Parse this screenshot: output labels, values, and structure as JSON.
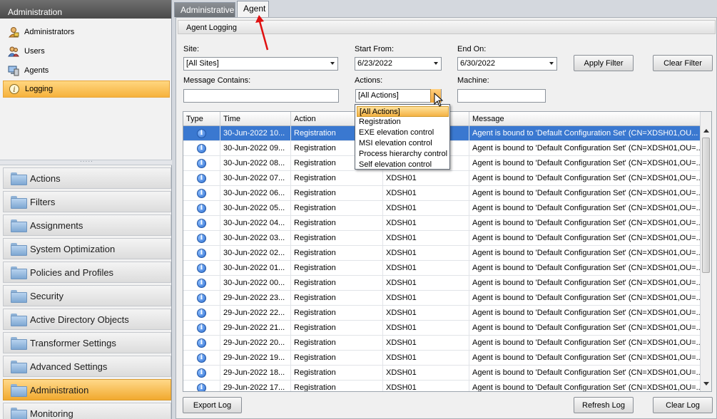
{
  "left": {
    "header": "Administration",
    "items": [
      {
        "label": "Administrators",
        "icon": "administrators-icon"
      },
      {
        "label": "Users",
        "icon": "users-icon"
      },
      {
        "label": "Agents",
        "icon": "agents-icon"
      },
      {
        "label": "Logging",
        "icon": "info-icon",
        "selected": true
      }
    ],
    "groups": [
      {
        "label": "Actions"
      },
      {
        "label": "Filters"
      },
      {
        "label": "Assignments"
      },
      {
        "label": "System Optimization"
      },
      {
        "label": "Policies and Profiles"
      },
      {
        "label": "Security"
      },
      {
        "label": "Active Directory Objects"
      },
      {
        "label": "Transformer Settings"
      },
      {
        "label": "Advanced Settings"
      },
      {
        "label": "Administration",
        "selected": true
      },
      {
        "label": "Monitoring"
      }
    ]
  },
  "tabs": [
    {
      "label": "Administrative",
      "active": false
    },
    {
      "label": "Agent",
      "active": true
    }
  ],
  "section_title": "Agent Logging",
  "filters": {
    "site_label": "Site:",
    "site_value": "[All Sites]",
    "start_label": "Start From:",
    "start_value": "6/23/2022",
    "end_label": "End On:",
    "end_value": "6/30/2022",
    "message_label": "Message Contains:",
    "message_value": "",
    "actions_label": "Actions:",
    "actions_value": "[All Actions]",
    "machine_label": "Machine:",
    "machine_value": "",
    "apply_label": "Apply Filter",
    "clear_label": "Clear Filter"
  },
  "actions_dropdown": {
    "options": [
      "[All Actions]",
      "Registration",
      "EXE elevation control",
      "MSI elevation control",
      "Process hierarchy control",
      "Self elevation control"
    ],
    "selected_index": 0
  },
  "grid": {
    "columns": [
      "Type",
      "Time",
      "Action",
      "",
      "Message"
    ],
    "rows": [
      {
        "time": "30-Jun-2022 10...",
        "action": "Registration",
        "machine": "",
        "message": "Agent is bound to 'Default Configuration Set' (CN=XDSH01,OU..."
      },
      {
        "time": "30-Jun-2022 09...",
        "action": "Registration",
        "machine": "",
        "message": "Agent is bound to 'Default Configuration Set' (CN=XDSH01,OU=..."
      },
      {
        "time": "30-Jun-2022 08...",
        "action": "Registration",
        "machine": "",
        "message": "Agent is bound to 'Default Configuration Set' (CN=XDSH01,OU=..."
      },
      {
        "time": "30-Jun-2022 07...",
        "action": "Registration",
        "machine": "XDSH01",
        "message": "Agent is bound to 'Default Configuration Set' (CN=XDSH01,OU=..."
      },
      {
        "time": "30-Jun-2022 06...",
        "action": "Registration",
        "machine": "XDSH01",
        "message": "Agent is bound to 'Default Configuration Set' (CN=XDSH01,OU=..."
      },
      {
        "time": "30-Jun-2022 05...",
        "action": "Registration",
        "machine": "XDSH01",
        "message": "Agent is bound to 'Default Configuration Set' (CN=XDSH01,OU=..."
      },
      {
        "time": "30-Jun-2022 04...",
        "action": "Registration",
        "machine": "XDSH01",
        "message": "Agent is bound to 'Default Configuration Set' (CN=XDSH01,OU=..."
      },
      {
        "time": "30-Jun-2022 03...",
        "action": "Registration",
        "machine": "XDSH01",
        "message": "Agent is bound to 'Default Configuration Set' (CN=XDSH01,OU=..."
      },
      {
        "time": "30-Jun-2022 02...",
        "action": "Registration",
        "machine": "XDSH01",
        "message": "Agent is bound to 'Default Configuration Set' (CN=XDSH01,OU=..."
      },
      {
        "time": "30-Jun-2022 01...",
        "action": "Registration",
        "machine": "XDSH01",
        "message": "Agent is bound to 'Default Configuration Set' (CN=XDSH01,OU=..."
      },
      {
        "time": "30-Jun-2022 00...",
        "action": "Registration",
        "machine": "XDSH01",
        "message": "Agent is bound to 'Default Configuration Set' (CN=XDSH01,OU=..."
      },
      {
        "time": "29-Jun-2022 23...",
        "action": "Registration",
        "machine": "XDSH01",
        "message": "Agent is bound to 'Default Configuration Set' (CN=XDSH01,OU=..."
      },
      {
        "time": "29-Jun-2022 22...",
        "action": "Registration",
        "machine": "XDSH01",
        "message": "Agent is bound to 'Default Configuration Set' (CN=XDSH01,OU=..."
      },
      {
        "time": "29-Jun-2022 21...",
        "action": "Registration",
        "machine": "XDSH01",
        "message": "Agent is bound to 'Default Configuration Set' (CN=XDSH01,OU=..."
      },
      {
        "time": "29-Jun-2022 20...",
        "action": "Registration",
        "machine": "XDSH01",
        "message": "Agent is bound to 'Default Configuration Set' (CN=XDSH01,OU=..."
      },
      {
        "time": "29-Jun-2022 19...",
        "action": "Registration",
        "machine": "XDSH01",
        "message": "Agent is bound to 'Default Configuration Set' (CN=XDSH01,OU=..."
      },
      {
        "time": "29-Jun-2022 18...",
        "action": "Registration",
        "machine": "XDSH01",
        "message": "Agent is bound to 'Default Configuration Set' (CN=XDSH01,OU=..."
      },
      {
        "time": "29-Jun-2022 17...",
        "action": "Registration",
        "machine": "XDSH01",
        "message": "Agent is bound to 'Default Configuration Set' (CN=XDSH01,OU=..."
      }
    ],
    "selected_row": 0,
    "row_icon": "info-icon"
  },
  "footer": {
    "export_label": "Export Log",
    "refresh_label": "Refresh Log",
    "clear_log_label": "Clear Log"
  },
  "colors": {
    "selection_orange": "#f6b23c",
    "row_selected_blue": "#3a78d0",
    "annotation_red": "#e01010"
  }
}
